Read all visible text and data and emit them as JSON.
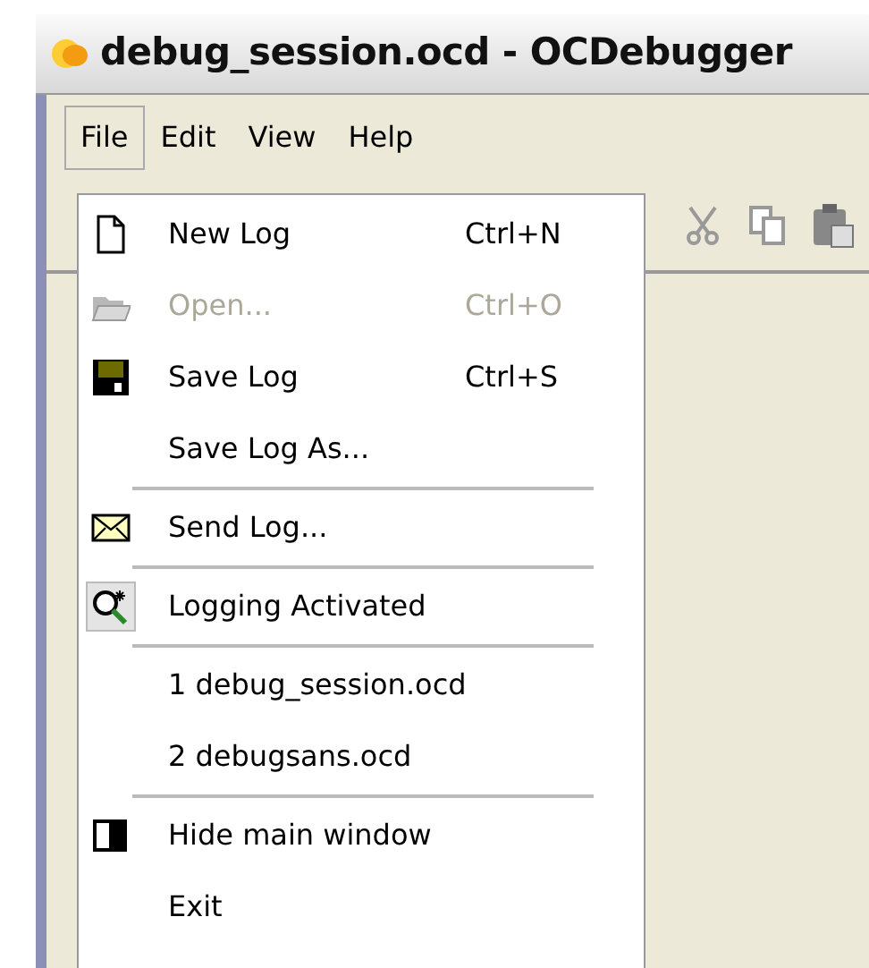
{
  "window": {
    "title": "debug_session.ocd - OCDebugger"
  },
  "menubar": [
    {
      "label": "File",
      "selected": true
    },
    {
      "label": "Edit",
      "selected": false
    },
    {
      "label": "View",
      "selected": false
    },
    {
      "label": "Help",
      "selected": false
    }
  ],
  "menu": [
    {
      "kind": "item",
      "label": "New Log",
      "shortcut": "Ctrl+N",
      "disabled": false
    },
    {
      "kind": "item",
      "label": "Open...",
      "shortcut": "Ctrl+O",
      "disabled": true
    },
    {
      "kind": "item",
      "label": "Save Log",
      "shortcut": "Ctrl+S",
      "disabled": false
    },
    {
      "kind": "item",
      "label": "Save Log As...",
      "disabled": false
    },
    {
      "kind": "separator"
    },
    {
      "kind": "item",
      "label": "Send Log...",
      "disabled": false
    },
    {
      "kind": "separator"
    },
    {
      "kind": "item",
      "label": "Logging Activated",
      "disabled": false,
      "checked": true
    },
    {
      "kind": "separator"
    },
    {
      "kind": "item",
      "label": "1 debug_session.ocd",
      "disabled": false
    },
    {
      "kind": "item",
      "label": "2 debugsans.ocd",
      "disabled": false
    },
    {
      "kind": "separator"
    },
    {
      "kind": "item",
      "label": "Hide main window",
      "disabled": false
    },
    {
      "kind": "item",
      "label": "Exit",
      "disabled": false
    }
  ]
}
